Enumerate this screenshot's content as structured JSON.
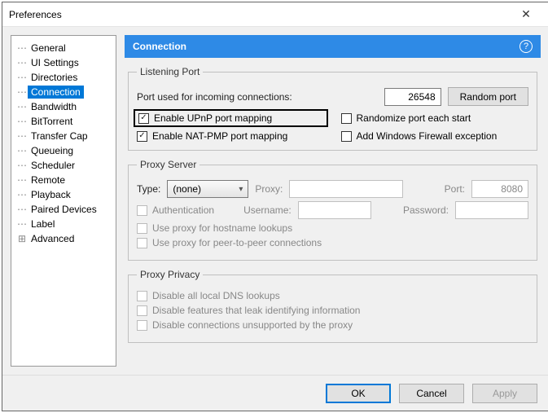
{
  "window": {
    "title": "Preferences"
  },
  "sidebar": {
    "items": [
      {
        "label": "General"
      },
      {
        "label": "UI Settings"
      },
      {
        "label": "Directories"
      },
      {
        "label": "Connection",
        "selected": true
      },
      {
        "label": "Bandwidth"
      },
      {
        "label": "BitTorrent"
      },
      {
        "label": "Transfer Cap"
      },
      {
        "label": "Queueing"
      },
      {
        "label": "Scheduler"
      },
      {
        "label": "Remote"
      },
      {
        "label": "Playback"
      },
      {
        "label": "Paired Devices"
      },
      {
        "label": "Label"
      },
      {
        "label": "Advanced",
        "expander": "plus"
      }
    ]
  },
  "header": {
    "title": "Connection"
  },
  "listening_port": {
    "legend": "Listening Port",
    "port_label": "Port used for incoming connections:",
    "port_value": "26548",
    "random_button": "Random port",
    "upnp": {
      "label": "Enable UPnP port mapping",
      "checked": true
    },
    "natpmp": {
      "label": "Enable NAT-PMP port mapping",
      "checked": true
    },
    "randomize": {
      "label": "Randomize port each start",
      "checked": false
    },
    "firewall": {
      "label": "Add Windows Firewall exception",
      "checked": false
    }
  },
  "proxy_server": {
    "legend": "Proxy Server",
    "type_label": "Type:",
    "type_value": "(none)",
    "proxy_label": "Proxy:",
    "port_label": "Port:",
    "port_value": "8080",
    "auth": {
      "label": "Authentication"
    },
    "username_label": "Username:",
    "password_label": "Password:",
    "hostname": {
      "label": "Use proxy for hostname lookups"
    },
    "p2p": {
      "label": "Use proxy for peer-to-peer connections"
    }
  },
  "proxy_privacy": {
    "legend": "Proxy Privacy",
    "dns": {
      "label": "Disable all local DNS lookups"
    },
    "leak": {
      "label": "Disable features that leak identifying information"
    },
    "unsupported": {
      "label": "Disable connections unsupported by the proxy"
    }
  },
  "footer": {
    "ok": "OK",
    "cancel": "Cancel",
    "apply": "Apply"
  }
}
